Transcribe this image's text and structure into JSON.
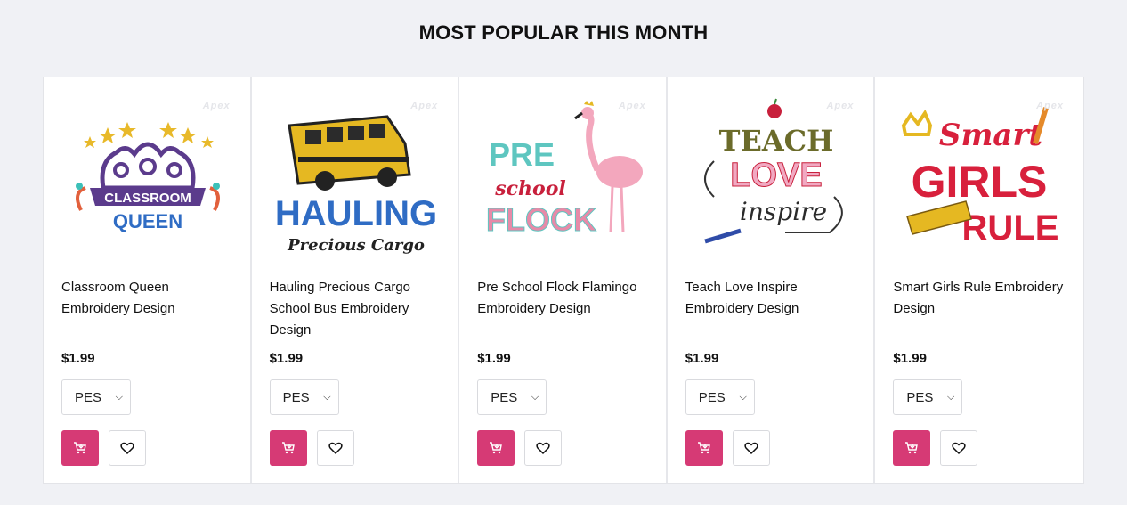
{
  "section": {
    "title": "MOST POPULAR THIS MONTH"
  },
  "colors": {
    "accent": "#d63a75",
    "background": "#f0f1f5"
  },
  "watermark": "Apex",
  "products": [
    {
      "title": "Classroom Queen Embroidery Design",
      "price": "$1.99",
      "format": "PES",
      "art": [
        "CLASSROOM",
        "QUEEN"
      ]
    },
    {
      "title": "Hauling Precious Cargo School Bus Embroidery Design",
      "price": "$1.99",
      "format": "PES",
      "art": [
        "HAULING",
        "Precious Cargo"
      ]
    },
    {
      "title": "Pre School Flock Flamingo Embroidery Design",
      "price": "$1.99",
      "format": "PES",
      "art": [
        "PRE",
        "school",
        "FLOCK"
      ]
    },
    {
      "title": "Teach Love Inspire Embroidery Design",
      "price": "$1.99",
      "format": "PES",
      "art": [
        "TEACH",
        "LOVE",
        "inspire"
      ]
    },
    {
      "title": "Smart Girls Rule Embroidery Design",
      "price": "$1.99",
      "format": "PES",
      "art": [
        "Smart",
        "GIRLS",
        "RULE"
      ]
    }
  ],
  "icons": {
    "cart": "cart-icon",
    "wishlist": "heart-icon",
    "dropdown": "chevron-down-icon"
  }
}
